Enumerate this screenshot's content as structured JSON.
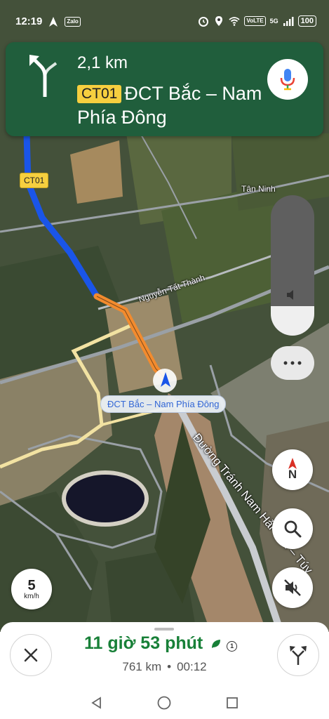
{
  "status_bar": {
    "time": "12:19",
    "zalo_label": "Zalo",
    "volte_label": "VoLTE",
    "network_label": "5G",
    "battery": "100"
  },
  "navigation": {
    "distance": "2,1 km",
    "road_badge": "CT01",
    "road_name": "ĐCT Bắc – Nam Phía Đông"
  },
  "map": {
    "ct01_badge": "CT01",
    "labels": {
      "tan_ninh": "Tân Ninh",
      "nguyen_tat_thanh": "Nguyễn Tất Thành",
      "current_street": "ĐCT Bắc – Nam Phía Đông",
      "duong_tranh": "Đường Tránh Nam Hải Vân – Túy"
    }
  },
  "speed": {
    "value": "5",
    "unit": "km/h"
  },
  "compass": {
    "label": "N"
  },
  "trip": {
    "eta_duration": "11 giờ 53 phút",
    "distance": "761 km",
    "arrival_time": "00:12",
    "incident_count": "1"
  },
  "colors": {
    "banner": "#205e3c",
    "route_blue": "#1a55e8",
    "route_orange": "#f28b2e",
    "eta_green": "#188038"
  }
}
